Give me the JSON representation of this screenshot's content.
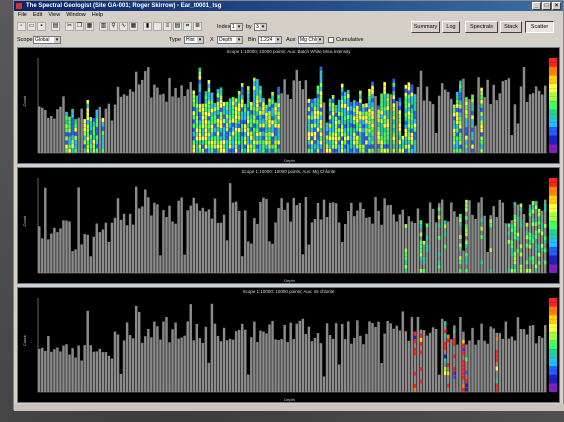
{
  "window": {
    "title": "The Spectral Geologist (Site GA-001; Roger Skirrow) - Ear_t0001_tsg"
  },
  "menu": [
    "File",
    "Edit",
    "View",
    "Window",
    "Help"
  ],
  "toolbar": {
    "index_label": "Index",
    "index_value": "1",
    "of_label": "by",
    "of_value": "3",
    "scope_label": "Scope",
    "scope_value": "Global",
    "type_label": "Type",
    "type_value": "Hist",
    "x_label": "X",
    "x_value": "Depth",
    "bin_label": "Bin",
    "bin_value": "1.224",
    "aux_label": "Aux",
    "aux_value": "Mg Chlor",
    "cumulative_label": "Cumulative"
  },
  "nav_buttons": [
    {
      "label": "Summary",
      "active": false
    },
    {
      "label": "Log",
      "active": false
    },
    {
      "label": "Spectrals",
      "active": false
    },
    {
      "label": "Stack",
      "active": false
    },
    {
      "label": "Scatter",
      "active": true
    }
  ],
  "panels": [
    {
      "title": "Scope 1:10000;  10000 points;  Aux: Batch White Mica Intensity",
      "ylabel": "Count",
      "xlabel": "Depth",
      "colored": "wide"
    },
    {
      "title": "Scope 1:10000;  10000 points;  Aux: Mg Chlorite",
      "ylabel": "Count",
      "xlabel": "Depth",
      "colored": "sparse_green"
    },
    {
      "title": "Scope 1:10000;  10000 points;  Aux: Int chlorite",
      "ylabel": "Count",
      "xlabel": "Depth",
      "colored": "sparse_red"
    }
  ],
  "colors": {
    "bar_gray": "#8a8a8a",
    "panel_bg": "#000000",
    "title_bar": "#0a246a"
  }
}
